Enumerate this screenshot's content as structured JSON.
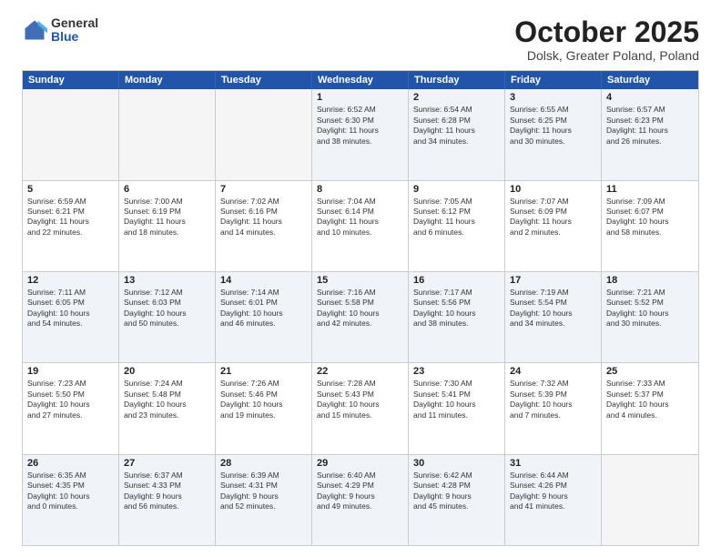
{
  "header": {
    "logo_general": "General",
    "logo_blue": "Blue",
    "month": "October 2025",
    "location": "Dolsk, Greater Poland, Poland"
  },
  "weekdays": [
    "Sunday",
    "Monday",
    "Tuesday",
    "Wednesday",
    "Thursday",
    "Friday",
    "Saturday"
  ],
  "rows": [
    [
      {
        "day": "",
        "text": ""
      },
      {
        "day": "",
        "text": ""
      },
      {
        "day": "",
        "text": ""
      },
      {
        "day": "1",
        "text": "Sunrise: 6:52 AM\nSunset: 6:30 PM\nDaylight: 11 hours\nand 38 minutes."
      },
      {
        "day": "2",
        "text": "Sunrise: 6:54 AM\nSunset: 6:28 PM\nDaylight: 11 hours\nand 34 minutes."
      },
      {
        "day": "3",
        "text": "Sunrise: 6:55 AM\nSunset: 6:25 PM\nDaylight: 11 hours\nand 30 minutes."
      },
      {
        "day": "4",
        "text": "Sunrise: 6:57 AM\nSunset: 6:23 PM\nDaylight: 11 hours\nand 26 minutes."
      }
    ],
    [
      {
        "day": "5",
        "text": "Sunrise: 6:59 AM\nSunset: 6:21 PM\nDaylight: 11 hours\nand 22 minutes."
      },
      {
        "day": "6",
        "text": "Sunrise: 7:00 AM\nSunset: 6:19 PM\nDaylight: 11 hours\nand 18 minutes."
      },
      {
        "day": "7",
        "text": "Sunrise: 7:02 AM\nSunset: 6:16 PM\nDaylight: 11 hours\nand 14 minutes."
      },
      {
        "day": "8",
        "text": "Sunrise: 7:04 AM\nSunset: 6:14 PM\nDaylight: 11 hours\nand 10 minutes."
      },
      {
        "day": "9",
        "text": "Sunrise: 7:05 AM\nSunset: 6:12 PM\nDaylight: 11 hours\nand 6 minutes."
      },
      {
        "day": "10",
        "text": "Sunrise: 7:07 AM\nSunset: 6:09 PM\nDaylight: 11 hours\nand 2 minutes."
      },
      {
        "day": "11",
        "text": "Sunrise: 7:09 AM\nSunset: 6:07 PM\nDaylight: 10 hours\nand 58 minutes."
      }
    ],
    [
      {
        "day": "12",
        "text": "Sunrise: 7:11 AM\nSunset: 6:05 PM\nDaylight: 10 hours\nand 54 minutes."
      },
      {
        "day": "13",
        "text": "Sunrise: 7:12 AM\nSunset: 6:03 PM\nDaylight: 10 hours\nand 50 minutes."
      },
      {
        "day": "14",
        "text": "Sunrise: 7:14 AM\nSunset: 6:01 PM\nDaylight: 10 hours\nand 46 minutes."
      },
      {
        "day": "15",
        "text": "Sunrise: 7:16 AM\nSunset: 5:58 PM\nDaylight: 10 hours\nand 42 minutes."
      },
      {
        "day": "16",
        "text": "Sunrise: 7:17 AM\nSunset: 5:56 PM\nDaylight: 10 hours\nand 38 minutes."
      },
      {
        "day": "17",
        "text": "Sunrise: 7:19 AM\nSunset: 5:54 PM\nDaylight: 10 hours\nand 34 minutes."
      },
      {
        "day": "18",
        "text": "Sunrise: 7:21 AM\nSunset: 5:52 PM\nDaylight: 10 hours\nand 30 minutes."
      }
    ],
    [
      {
        "day": "19",
        "text": "Sunrise: 7:23 AM\nSunset: 5:50 PM\nDaylight: 10 hours\nand 27 minutes."
      },
      {
        "day": "20",
        "text": "Sunrise: 7:24 AM\nSunset: 5:48 PM\nDaylight: 10 hours\nand 23 minutes."
      },
      {
        "day": "21",
        "text": "Sunrise: 7:26 AM\nSunset: 5:46 PM\nDaylight: 10 hours\nand 19 minutes."
      },
      {
        "day": "22",
        "text": "Sunrise: 7:28 AM\nSunset: 5:43 PM\nDaylight: 10 hours\nand 15 minutes."
      },
      {
        "day": "23",
        "text": "Sunrise: 7:30 AM\nSunset: 5:41 PM\nDaylight: 10 hours\nand 11 minutes."
      },
      {
        "day": "24",
        "text": "Sunrise: 7:32 AM\nSunset: 5:39 PM\nDaylight: 10 hours\nand 7 minutes."
      },
      {
        "day": "25",
        "text": "Sunrise: 7:33 AM\nSunset: 5:37 PM\nDaylight: 10 hours\nand 4 minutes."
      }
    ],
    [
      {
        "day": "26",
        "text": "Sunrise: 6:35 AM\nSunset: 4:35 PM\nDaylight: 10 hours\nand 0 minutes."
      },
      {
        "day": "27",
        "text": "Sunrise: 6:37 AM\nSunset: 4:33 PM\nDaylight: 9 hours\nand 56 minutes."
      },
      {
        "day": "28",
        "text": "Sunrise: 6:39 AM\nSunset: 4:31 PM\nDaylight: 9 hours\nand 52 minutes."
      },
      {
        "day": "29",
        "text": "Sunrise: 6:40 AM\nSunset: 4:29 PM\nDaylight: 9 hours\nand 49 minutes."
      },
      {
        "day": "30",
        "text": "Sunrise: 6:42 AM\nSunset: 4:28 PM\nDaylight: 9 hours\nand 45 minutes."
      },
      {
        "day": "31",
        "text": "Sunrise: 6:44 AM\nSunset: 4:26 PM\nDaylight: 9 hours\nand 41 minutes."
      },
      {
        "day": "",
        "text": ""
      }
    ]
  ],
  "alt_rows": [
    0,
    2,
    4
  ]
}
